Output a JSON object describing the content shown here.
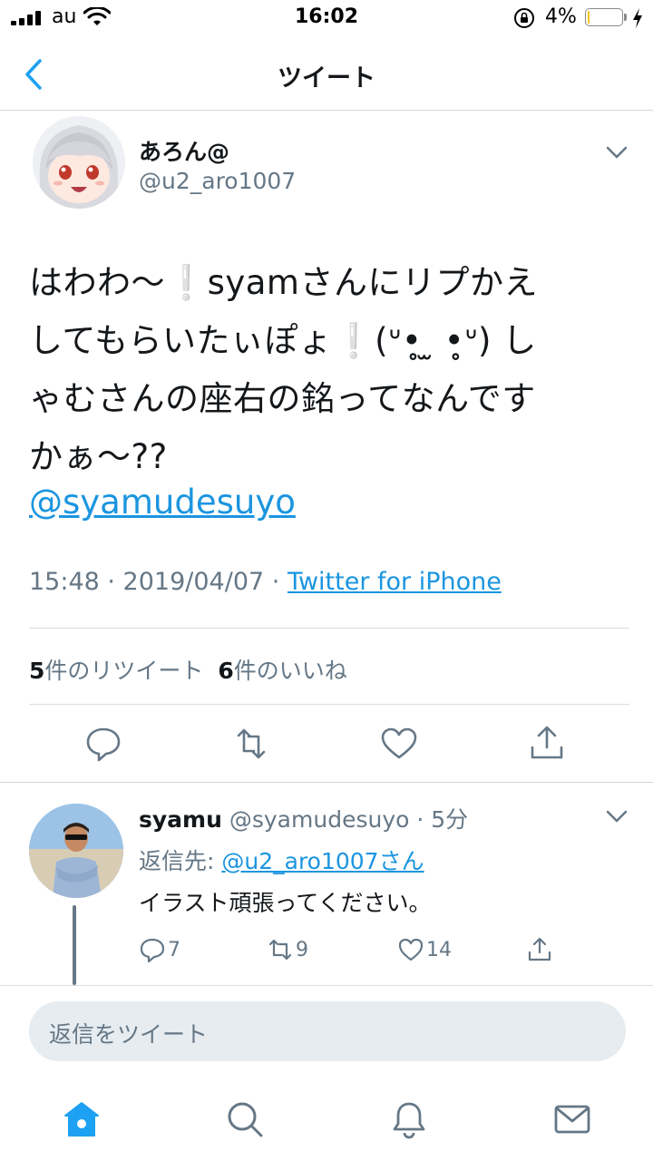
{
  "status_bar": {
    "carrier": "au",
    "time": "16:02",
    "battery_percent": "4%",
    "battery_level": 0.04,
    "battery_color": "#f5c518",
    "charging": true
  },
  "header": {
    "back_icon": "chevron-left-icon",
    "title": "ツイート"
  },
  "tweet": {
    "author_name": "あろん@",
    "author_handle": "@u2_aro1007",
    "text_lines": [
      "はわわ〜❕syamさんにリプかえ",
      "してもらいたぃぽょ❕(ᐡ•̥ ̫ •̥ᐡ) し",
      "ゃむさんの座右の銘ってなんです",
      "かぁ〜??"
    ],
    "mention": "@syamudesuyo",
    "timestamp": "15:48 · 2019/04/07 · ",
    "source": "Twitter for iPhone",
    "retweet_count": "5",
    "retweet_label": "件のリツイート",
    "like_count": "6",
    "like_label": "件のいいね",
    "actions": [
      "reply-icon",
      "retweet-icon",
      "like-icon",
      "share-icon"
    ]
  },
  "reply": {
    "name": "syamu",
    "handle": "@syamudesuyo",
    "time": "· 5分",
    "reply_to_label": "返信先: ",
    "reply_to_user": "@u2_aro1007さん",
    "text": "イラスト頑張ってください。",
    "reply_count": "7",
    "retweet_count": "9",
    "like_count": "14"
  },
  "composer": {
    "placeholder": "返信をツイート"
  },
  "tab_bar": {
    "items": [
      "home-icon",
      "search-icon",
      "notifications-icon",
      "messages-icon"
    ],
    "active_color": "#1da1f2"
  },
  "colors": {
    "accent": "#1b95e0",
    "secondary_text": "#657786",
    "primary_text": "#14171a"
  }
}
